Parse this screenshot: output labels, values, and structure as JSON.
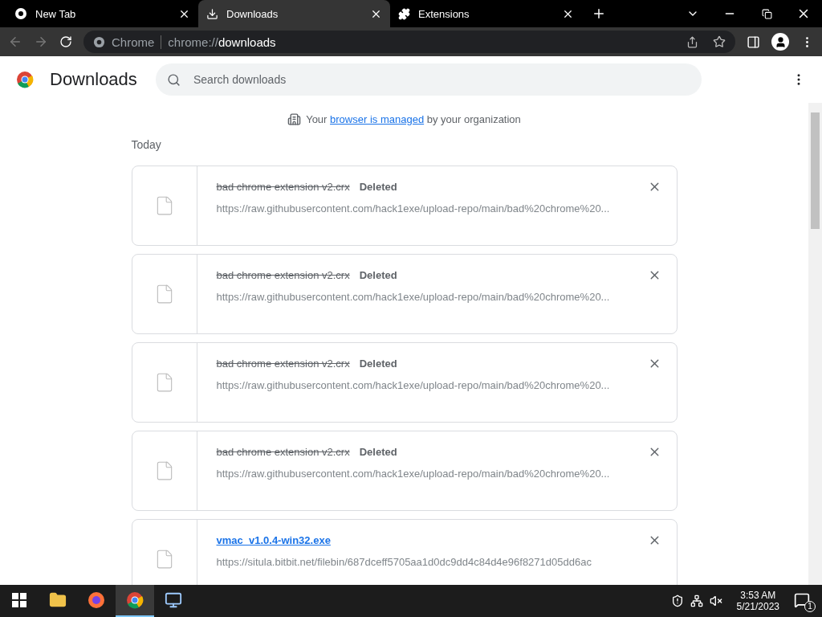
{
  "tabs": [
    {
      "title": "New Tab",
      "kind": "newtab",
      "selected": false
    },
    {
      "title": "Downloads",
      "kind": "download",
      "selected": true
    },
    {
      "title": "Extensions",
      "kind": "extension",
      "selected": false
    }
  ],
  "address": {
    "site": "Chrome",
    "prefix": "chrome://",
    "host": "downloads"
  },
  "header": {
    "title": "Downloads",
    "search_placeholder": "Search downloads"
  },
  "managed_notice": {
    "before": "Your",
    "link": "browser is managed",
    "after": "by your organization"
  },
  "section": "Today",
  "downloads": [
    {
      "name": "bad chrome extension v2.crx",
      "status": "Deleted",
      "deleted": true,
      "url": "https://raw.githubusercontent.com/hack1exe/upload-repo/main/bad%20chrome%20..."
    },
    {
      "name": "bad chrome extension v2.crx",
      "status": "Deleted",
      "deleted": true,
      "url": "https://raw.githubusercontent.com/hack1exe/upload-repo/main/bad%20chrome%20..."
    },
    {
      "name": "bad chrome extension v2.crx",
      "status": "Deleted",
      "deleted": true,
      "url": "https://raw.githubusercontent.com/hack1exe/upload-repo/main/bad%20chrome%20..."
    },
    {
      "name": "bad chrome extension v2.crx",
      "status": "Deleted",
      "deleted": true,
      "url": "https://raw.githubusercontent.com/hack1exe/upload-repo/main/bad%20chrome%20..."
    },
    {
      "name": "vmac_v1.0.4-win32.exe",
      "deleted": false,
      "url": "https://situla.bitbit.net/filebin/687dceff5705aa1d0dc9dd4c84d4e96f8271d05dd6ac"
    }
  ],
  "taskbar": {
    "time": "3:53 AM",
    "date": "5/21/2023",
    "notifications": "1",
    "apps": [
      {
        "kind": "folder",
        "selected": false
      },
      {
        "kind": "firefox",
        "selected": false
      },
      {
        "kind": "chrome",
        "selected": true
      },
      {
        "kind": "computer",
        "selected": false
      }
    ]
  }
}
